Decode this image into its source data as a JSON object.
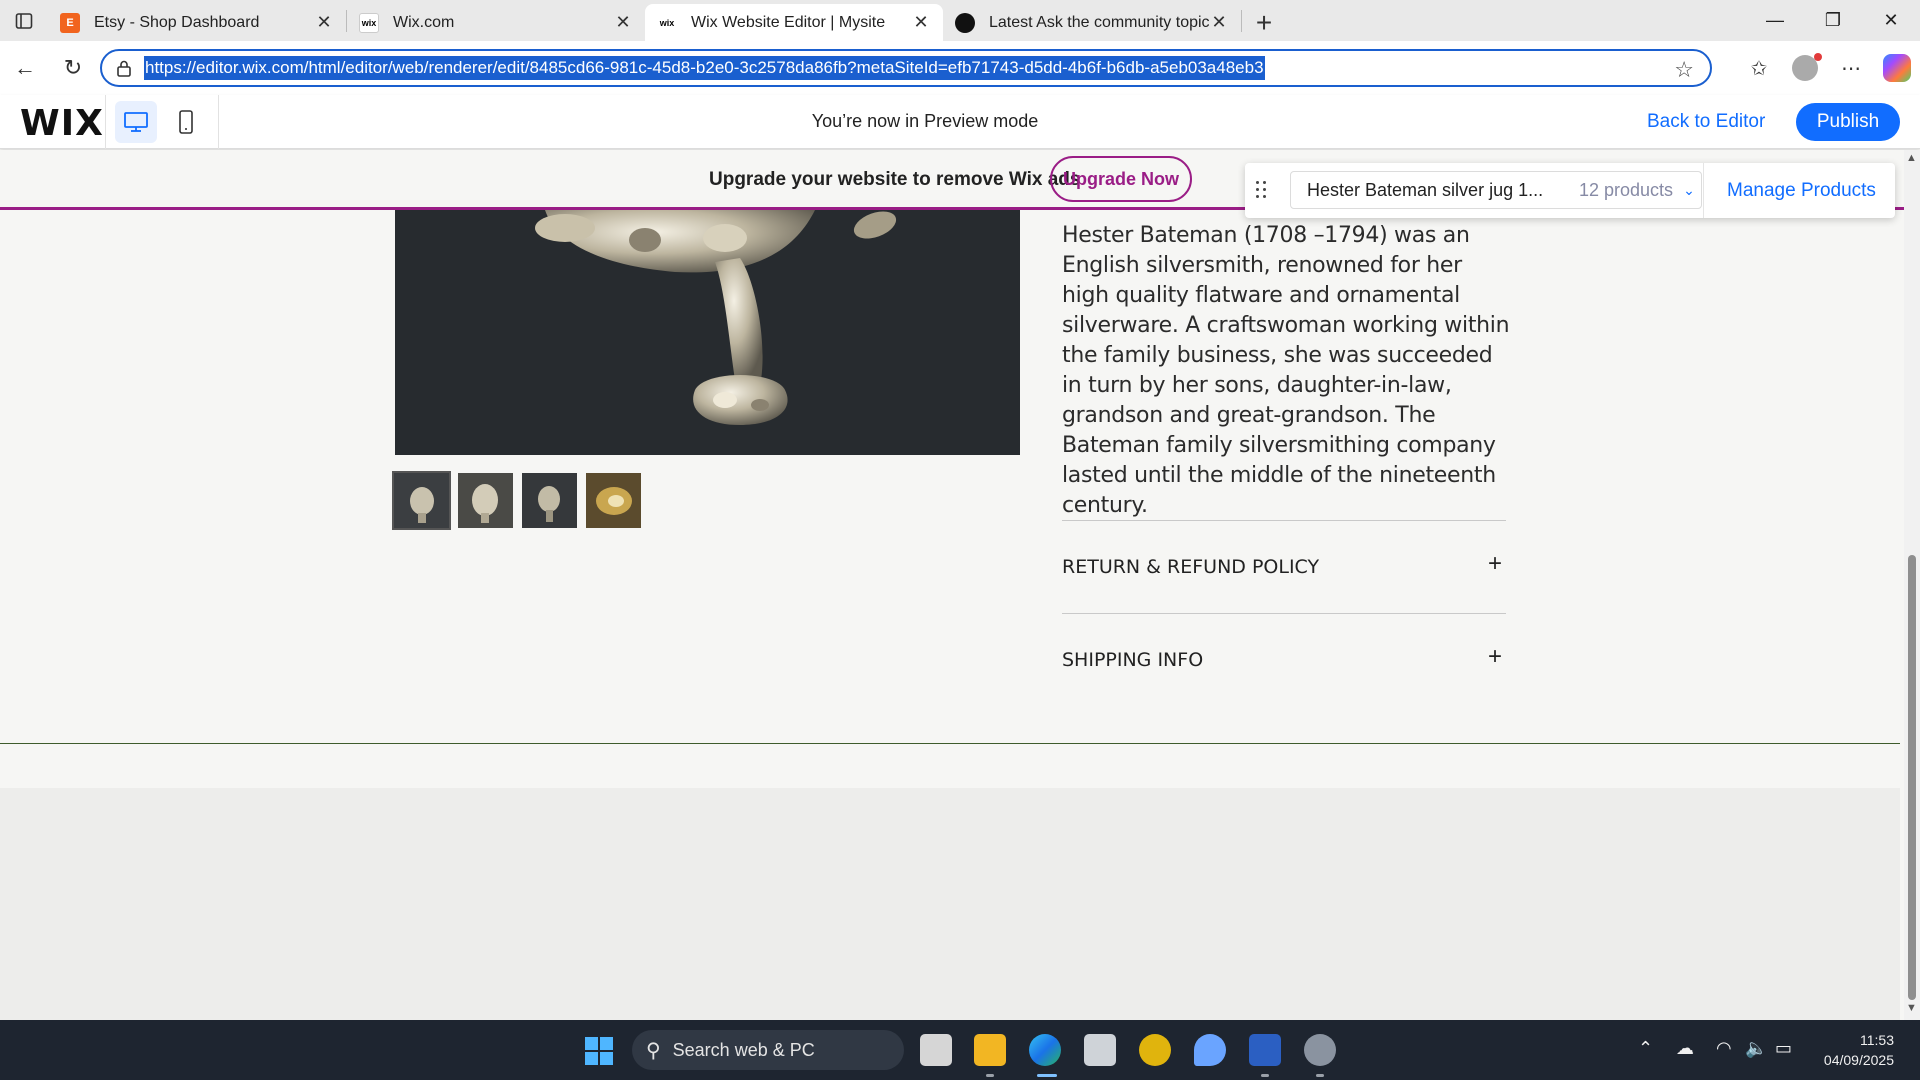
{
  "browser": {
    "tabs": [
      {
        "title": "Etsy - Shop Dashboard",
        "favicon": "E",
        "active": false
      },
      {
        "title": "Wix.com",
        "favicon": "wix",
        "active": false
      },
      {
        "title": "Wix Website Editor | Mysite",
        "favicon": "wix",
        "active": true
      },
      {
        "title": "Latest Ask the community topics",
        "favicon": "",
        "active": false
      }
    ],
    "url": "https://editor.wix.com/html/editor/web/renderer/edit/8485cd66-981c-45d8-b2e0-3c2578da86fb?metaSiteId=efb71743-d5dd-4b6f-b6db-a5eb03a48eb3"
  },
  "wix": {
    "logo": "WIX",
    "preview_message": "You’re now in Preview mode",
    "back_to_editor": "Back to Editor",
    "publish": "Publish"
  },
  "ad": {
    "text": "Upgrade your website to remove Wix ads",
    "button": "Upgrade Now"
  },
  "products_panel": {
    "selected_product": "Hester Bateman silver jug 1...",
    "count": "12 products",
    "manage": "Manage Products"
  },
  "product": {
    "description": "Hester Bateman (1708 –1794) was an English silversmith, renowned for her high quality flatware and ornamental silverware. A craftswoman working within the family business, she was succeeded in turn by her sons, daughter-in-law, grandson and great-grandson. The Bateman family silversmithing company lasted until the middle of the nineteenth century.",
    "thumbnail_count": 4,
    "sections": [
      {
        "title": "RETURN & REFUND POLICY",
        "icon": "plus-icon"
      },
      {
        "title": "SHIPPING INFO",
        "icon": "plus-icon"
      }
    ]
  },
  "taskbar": {
    "search_placeholder": "Search web & PC",
    "time": "11:53",
    "date": "04/09/2025"
  },
  "colors": {
    "wix_blue": "#116dff",
    "ad_purple": "#9a1d86",
    "url_highlight": "#1a5fcf"
  }
}
